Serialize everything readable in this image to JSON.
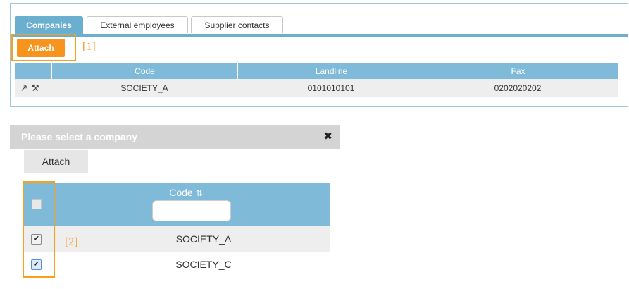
{
  "tabs": [
    {
      "label": "Companies",
      "active": true
    },
    {
      "label": "External employees",
      "active": false
    },
    {
      "label": "Supplier contacts",
      "active": false
    }
  ],
  "top": {
    "attach_label": "Attach",
    "callout": "[1]",
    "columns": [
      "Code",
      "Landline",
      "Fax"
    ],
    "rows": [
      {
        "code": "SOCIETY_A",
        "landline": "0101010101",
        "fax": "0202020202"
      }
    ],
    "row_icons": [
      "edit-icon",
      "tools-icon"
    ]
  },
  "dialog": {
    "title": "Please select a company",
    "close_icon": "close-icon",
    "attach_label": "Attach",
    "column_code": "Code",
    "sort_icon": "sort-icon",
    "filter_value": "",
    "callout": "[2]",
    "rows": [
      {
        "code": "SOCIETY_A",
        "checked": true
      },
      {
        "code": "SOCIETY_C",
        "checked": true
      }
    ]
  },
  "colors": {
    "accent_orange": "#f7941d",
    "header_blue": "#7fbad8",
    "tab_blue": "#6aaed0",
    "dialog_title_grey": "#d4d4d4"
  }
}
